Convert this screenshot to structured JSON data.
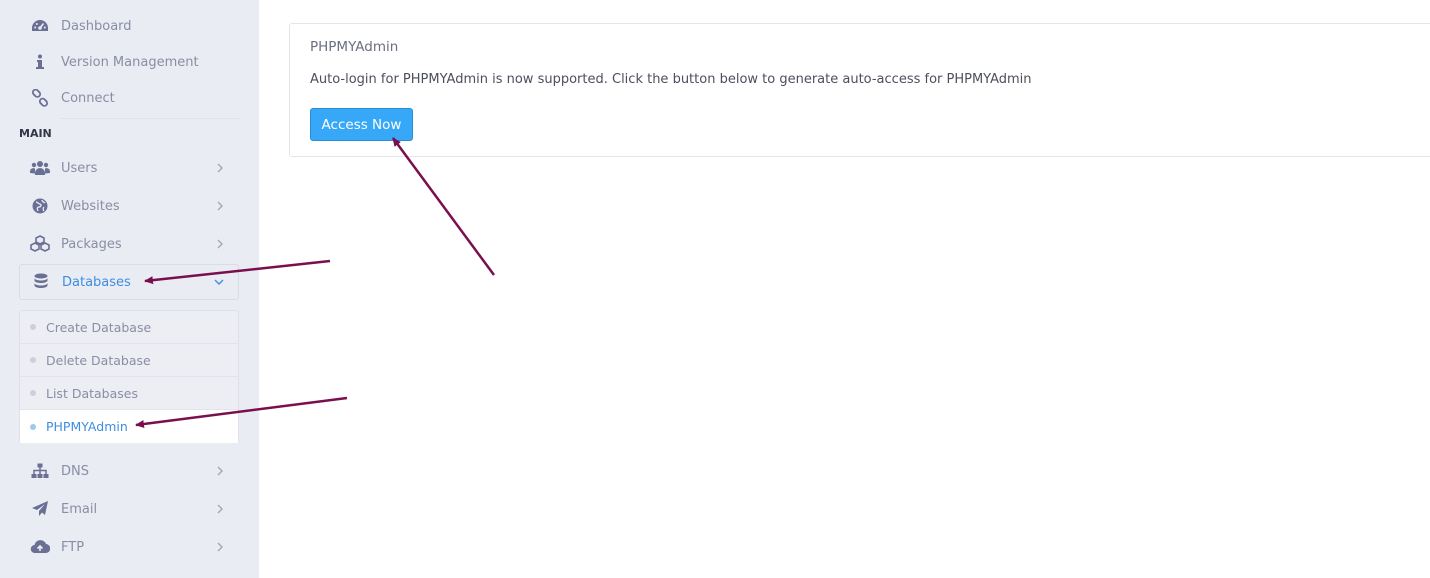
{
  "sidebar": {
    "top_items": [
      {
        "label": "Dashboard",
        "icon": "dashboard-icon"
      },
      {
        "label": "Version Management",
        "icon": "info-icon"
      },
      {
        "label": "Connect",
        "icon": "link-icon"
      }
    ],
    "section_title": "MAIN",
    "main_items": [
      {
        "label": "Users",
        "icon": "users-icon"
      },
      {
        "label": "Websites",
        "icon": "globe-icon"
      },
      {
        "label": "Packages",
        "icon": "cubes-icon"
      },
      {
        "label": "Databases",
        "icon": "database-icon"
      }
    ],
    "database_submenu": [
      {
        "label": "Create Database"
      },
      {
        "label": "Delete Database"
      },
      {
        "label": "List Databases"
      },
      {
        "label": "PHPMYAdmin"
      }
    ],
    "lower_items": [
      {
        "label": "DNS",
        "icon": "sitemap-icon"
      },
      {
        "label": "Email",
        "icon": "paper-plane-icon"
      },
      {
        "label": "FTP",
        "icon": "cloud-upload-icon"
      }
    ]
  },
  "card": {
    "title": "PHPMYAdmin",
    "description": "Auto-login for PHPMYAdmin is now supported. Click the button below to generate auto-access for PHPMYAdmin",
    "button_label": "Access Now"
  },
  "colors": {
    "sidebar_bg": "#eaecf3",
    "active_link": "#3e8ee0",
    "button_bg": "#37a8f7",
    "annotation_arrow": "#7a0f4d"
  }
}
